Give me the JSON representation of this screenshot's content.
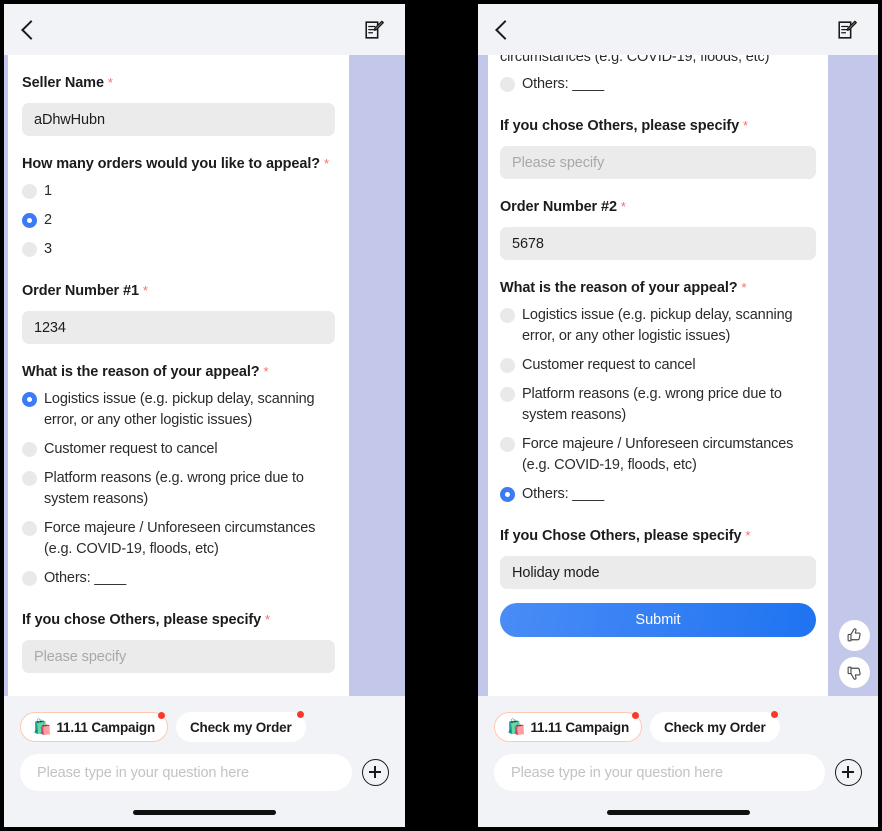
{
  "nav": {
    "back_icon": "back-chevron-icon",
    "edit_icon": "compose-edit-icon"
  },
  "left_panel": {
    "fields": {
      "seller_name_label": "Seller Name",
      "seller_name_value": "aDhwHubn",
      "orders_count_label": "How many orders would you like to appeal?",
      "orders_count_options": [
        "1",
        "2",
        "3"
      ],
      "orders_count_selected": 1,
      "order_number_1_label": "Order Number #1",
      "order_number_1_value": "1234",
      "reason_label": "What is the reason of your appeal?",
      "reason_options": [
        "Logistics issue (e.g. pickup delay, scanning error, or any other logistic issues)",
        "Customer request to cancel",
        "Platform reasons (e.g. wrong price due to system reasons)",
        "Force majeure / Unforeseen circumstances (e.g. COVID-19, floods, etc)",
        "Others: ____"
      ],
      "reason_selected": 0,
      "others_specify_label": "If you chose Others, please specify",
      "others_specify_placeholder": "Please specify"
    }
  },
  "right_panel": {
    "fields": {
      "partial_top_line": "circumstances (e.g. COVID-19, floods, etc)",
      "partial_others_option": "Others: ____",
      "others_specify_label_1": "If you chose Others, please specify",
      "others_specify_placeholder": "Please specify",
      "order_number_2_label": "Order Number #2",
      "order_number_2_value": "5678",
      "reason_label": "What is the reason of your appeal?",
      "reason_options": [
        "Logistics issue (e.g. pickup delay, scanning error, or any other logistic issues)",
        "Customer request to cancel",
        "Platform reasons (e.g. wrong price due to system reasons)",
        "Force majeure / Unforeseen circumstances (e.g. COVID-19, floods, etc)",
        "Others: ____"
      ],
      "reason_selected": 4,
      "others_specify_label_2": "If you Chose Others, please specify",
      "others_specify_value": "Holiday mode",
      "submit_label": "Submit"
    },
    "feedback": {
      "thumbs_up_icon": "thumbs-up-icon",
      "thumbs_down_icon": "thumbs-down-icon"
    }
  },
  "bottom_bar": {
    "chips": [
      {
        "emoji": "🛍️",
        "label": "11.11 Campaign",
        "has_badge": true,
        "outlined": true
      },
      {
        "emoji": "",
        "label": "Check my Order",
        "has_badge": true,
        "outlined": false
      }
    ],
    "composer_placeholder": "Please type in your question here",
    "plus_icon": "plus-circle-icon"
  },
  "colors": {
    "accent_blue": "#3b7bf5",
    "submit_gradient_from": "#4a8cf7",
    "submit_gradient_to": "#1f73f1",
    "required_star": "#ff6b6b",
    "chat_background": "#c3c7ea",
    "card_background": "#ffffff",
    "input_background": "#ebebeb",
    "badge_red": "#f83a2c",
    "chip_outline": "#ffc9b0"
  }
}
